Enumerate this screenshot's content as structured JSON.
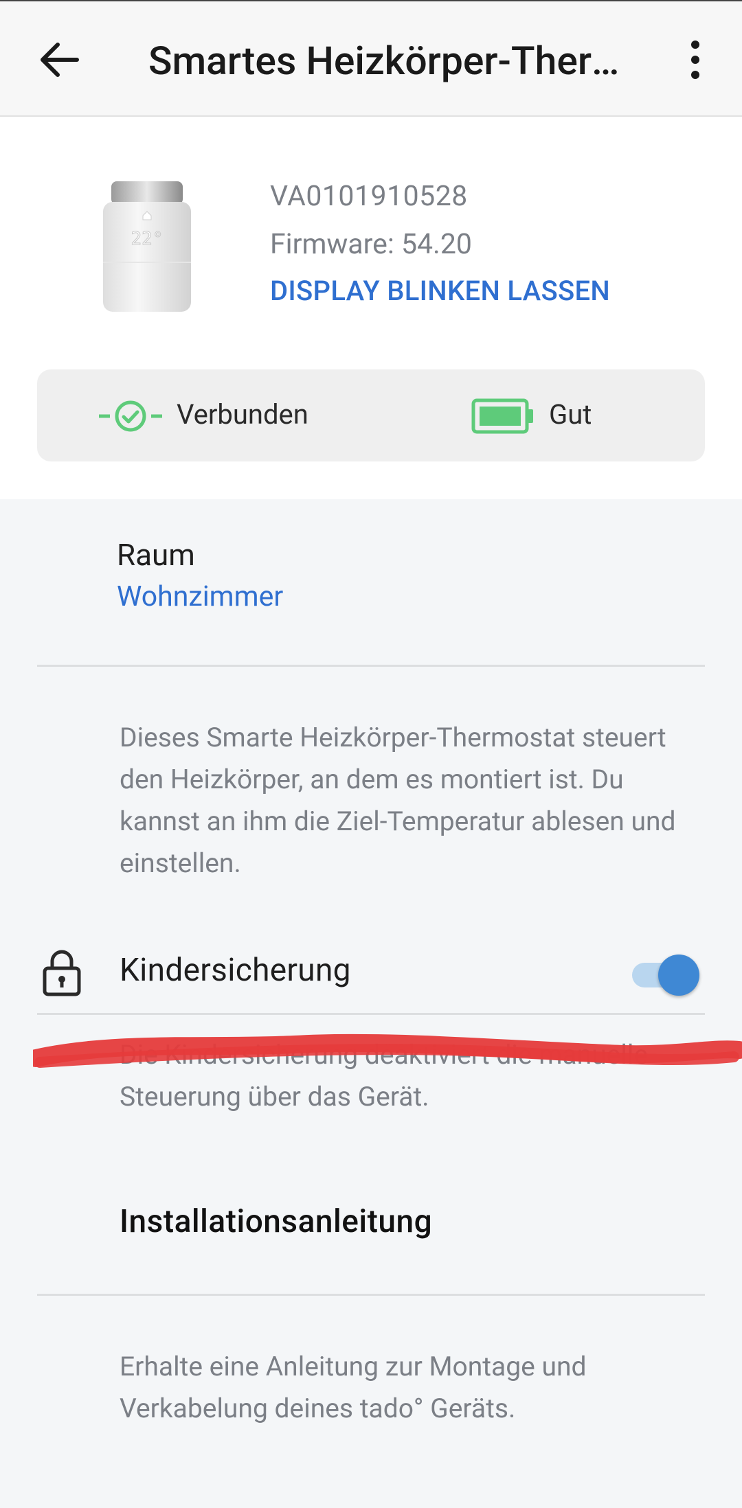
{
  "app_bar": {
    "title": "Smartes Heizkörper-Thermostat",
    "back_icon": "arrow-back-icon",
    "menu_icon": "more-vert-icon"
  },
  "device": {
    "image": "radiator-thermostat-device-image",
    "serial": "VA0101910528",
    "firmware": "Firmware: 54.20",
    "blink_action": "DISPLAY BLINKEN LASSEN"
  },
  "status": {
    "connection_label": "Verbunden",
    "connection_icon": "connected-check-icon",
    "battery_label": "Gut",
    "battery_icon": "battery-full-icon",
    "colors": {
      "ok_green": "#5ecb7a",
      "link_blue": "#2f6fd0",
      "toggle_blue": "#3f88d4"
    }
  },
  "room": {
    "label": "Raum",
    "value": "Wohnzimmer"
  },
  "description": "Dieses Smarte Heizkörper-Thermostat steuert den Heizkörper, an dem es montiert ist. Du kannst an ihm die Ziel-Temperatur ablesen und einstellen.",
  "child_lock": {
    "label": "Kindersicherung",
    "icon": "lock-icon",
    "enabled": true,
    "description": "Die Kindersicherung deaktiviert die manuelle Steuerung über das Gerät."
  },
  "installation": {
    "title": "Installationsanleitung",
    "description": "Erhalte eine Anleitung zur Montage und Verkabelung deines tado° Geräts."
  }
}
